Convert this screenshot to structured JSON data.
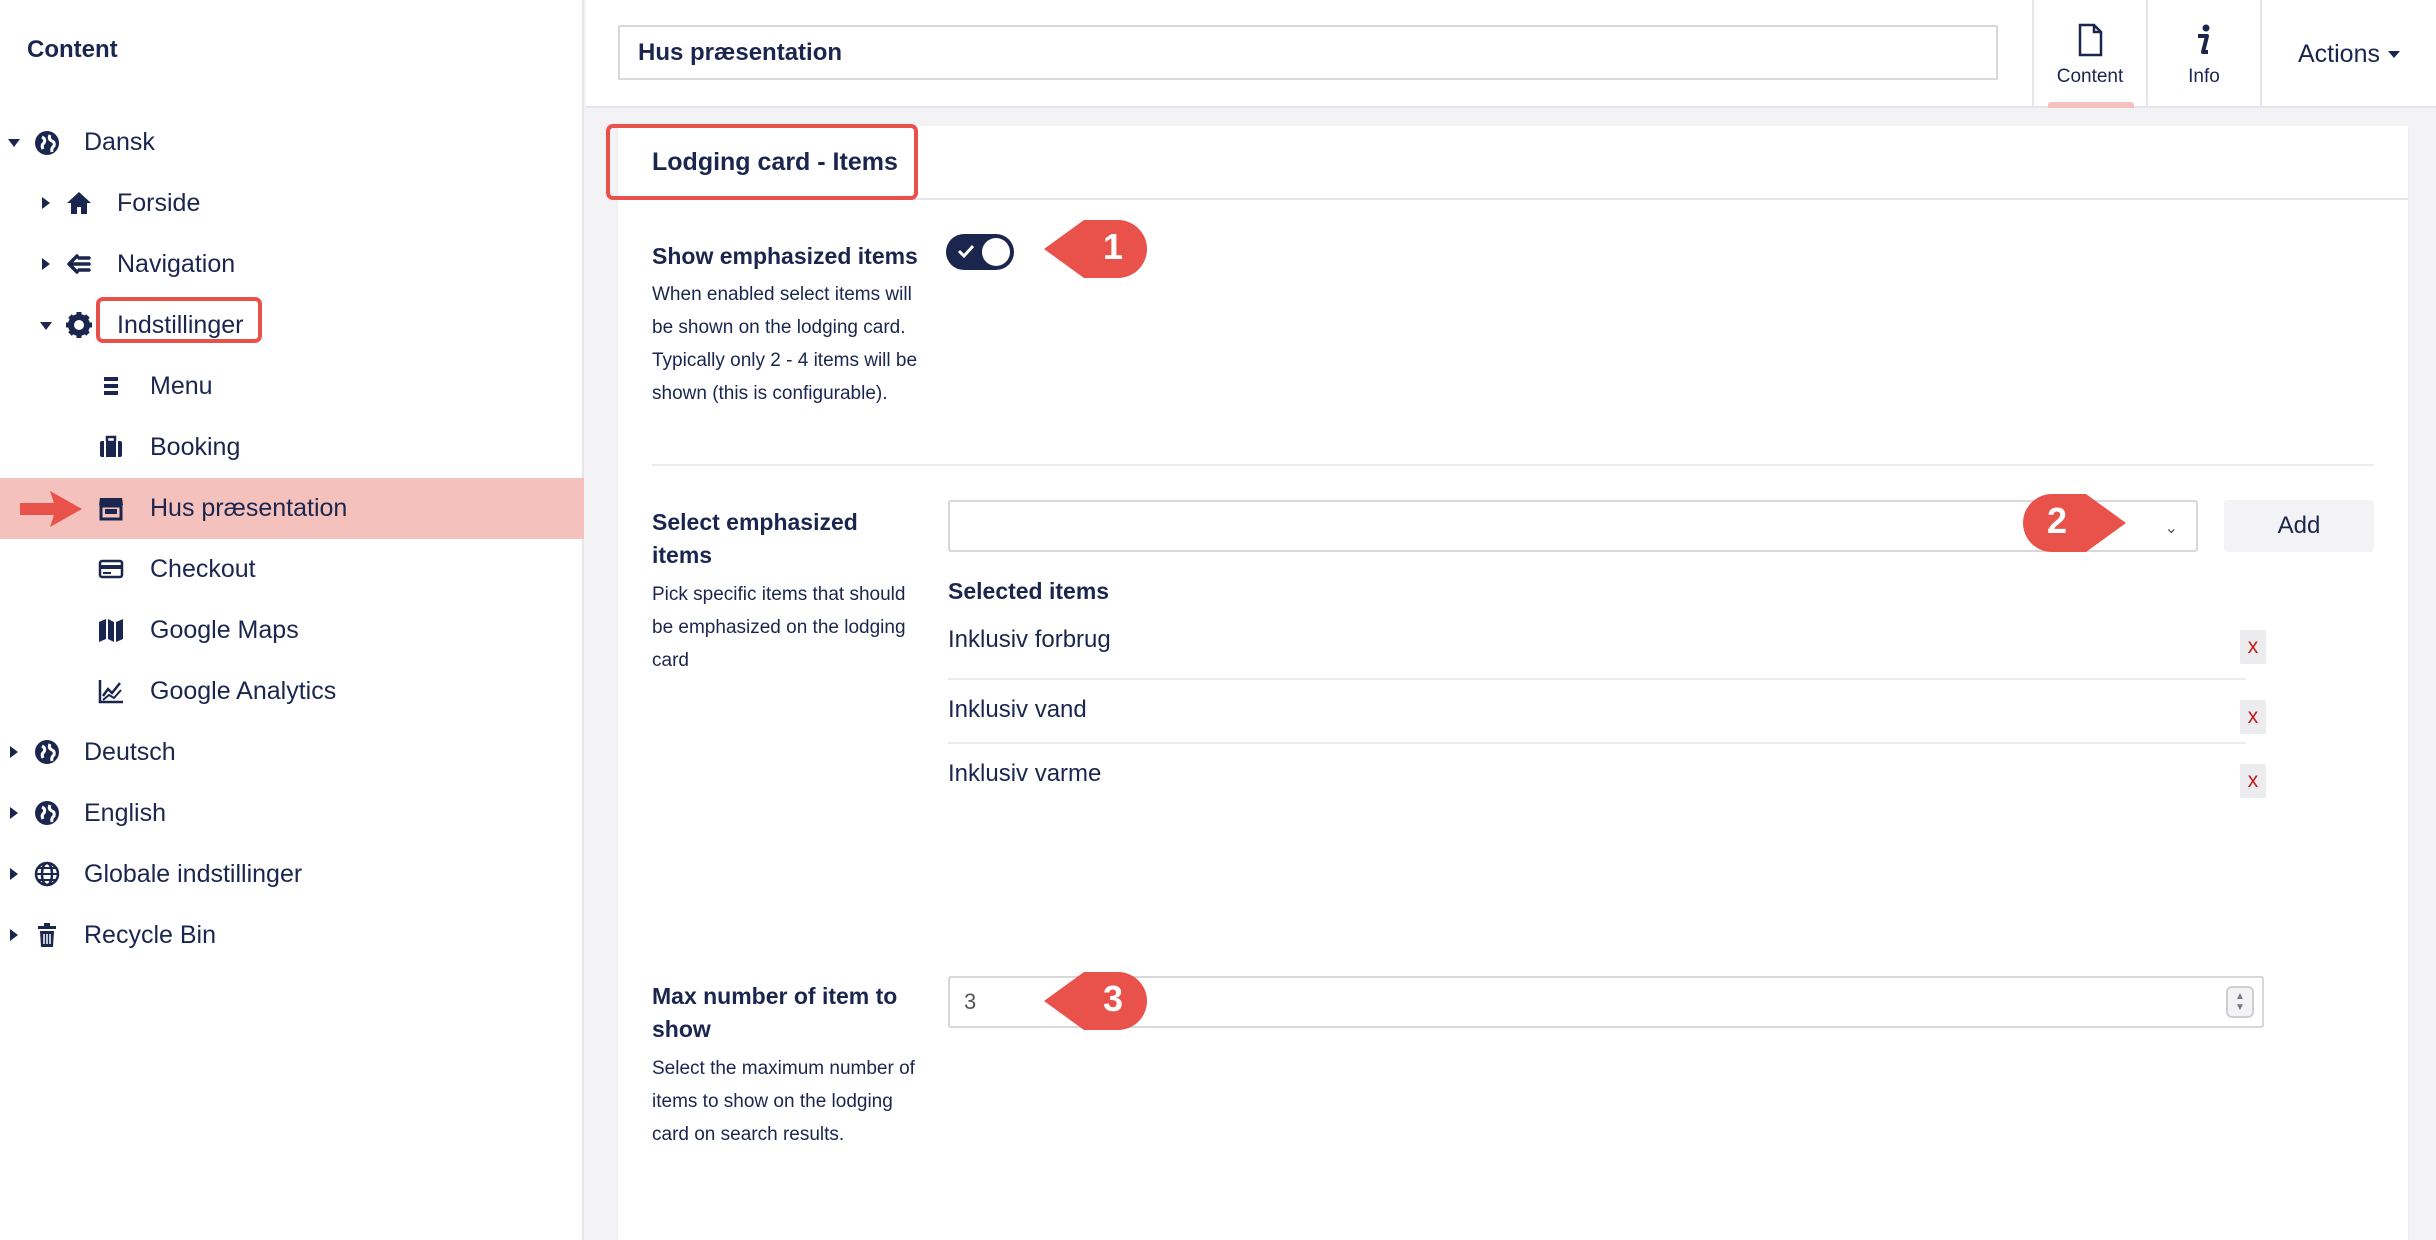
{
  "sidebar": {
    "header": "Content",
    "items": [
      {
        "label": "Dansk",
        "icon": "globe-icon",
        "expanded": true
      },
      {
        "label": "Forside",
        "icon": "home-icon",
        "expanded": false
      },
      {
        "label": "Navigation",
        "icon": "navigation-icon",
        "expanded": false
      },
      {
        "label": "Indstillinger",
        "icon": "gear-icon",
        "expanded": true
      },
      {
        "label": "Menu",
        "icon": "menu-icon"
      },
      {
        "label": "Booking",
        "icon": "briefcase-icon"
      },
      {
        "label": "Hus præsentation",
        "icon": "store-icon",
        "active": true
      },
      {
        "label": "Checkout",
        "icon": "credit-card-icon"
      },
      {
        "label": "Google Maps",
        "icon": "map-icon"
      },
      {
        "label": "Google Analytics",
        "icon": "chart-icon"
      },
      {
        "label": "Deutsch",
        "icon": "globe-icon",
        "expanded": false
      },
      {
        "label": "English",
        "icon": "globe-icon",
        "expanded": false
      },
      {
        "label": "Globale indstillinger",
        "icon": "world-icon",
        "expanded": false
      },
      {
        "label": "Recycle Bin",
        "icon": "trash-icon",
        "expanded": false
      }
    ]
  },
  "header": {
    "node_name": "Hus præsentation",
    "tabs": [
      {
        "label": "Content",
        "icon": "document-icon",
        "active": true
      },
      {
        "label": "Info",
        "icon": "info-icon"
      }
    ],
    "actions_label": "Actions"
  },
  "panel": {
    "title": "Lodging card - Items",
    "properties": {
      "show_emphasized": {
        "label": "Show emphasized items",
        "description": "When enabled select items will be shown on the lodging card. Typically only 2 - 4 items will be shown (this is configurable).",
        "enabled": true
      },
      "select_emphasized": {
        "label": "Select emphasized items",
        "description": "Pick specific items that should be emphasized on the lodging card",
        "select_value": "",
        "add_label": "Add",
        "selected_heading": "Selected items",
        "selected_items": [
          "Inklusiv forbrug",
          "Inklusiv vand",
          "Inklusiv varme"
        ],
        "remove_label": "x"
      },
      "max_items": {
        "label": "Max number of item to show",
        "description": "Select the maximum number of items to show on the lodging card on search results.",
        "value": "3"
      }
    }
  },
  "callouts": [
    "1",
    "2",
    "3"
  ],
  "colors": {
    "brand_navy": "#1b264f",
    "highlight": "#e8524a",
    "active_bg": "#f5c1bc"
  }
}
